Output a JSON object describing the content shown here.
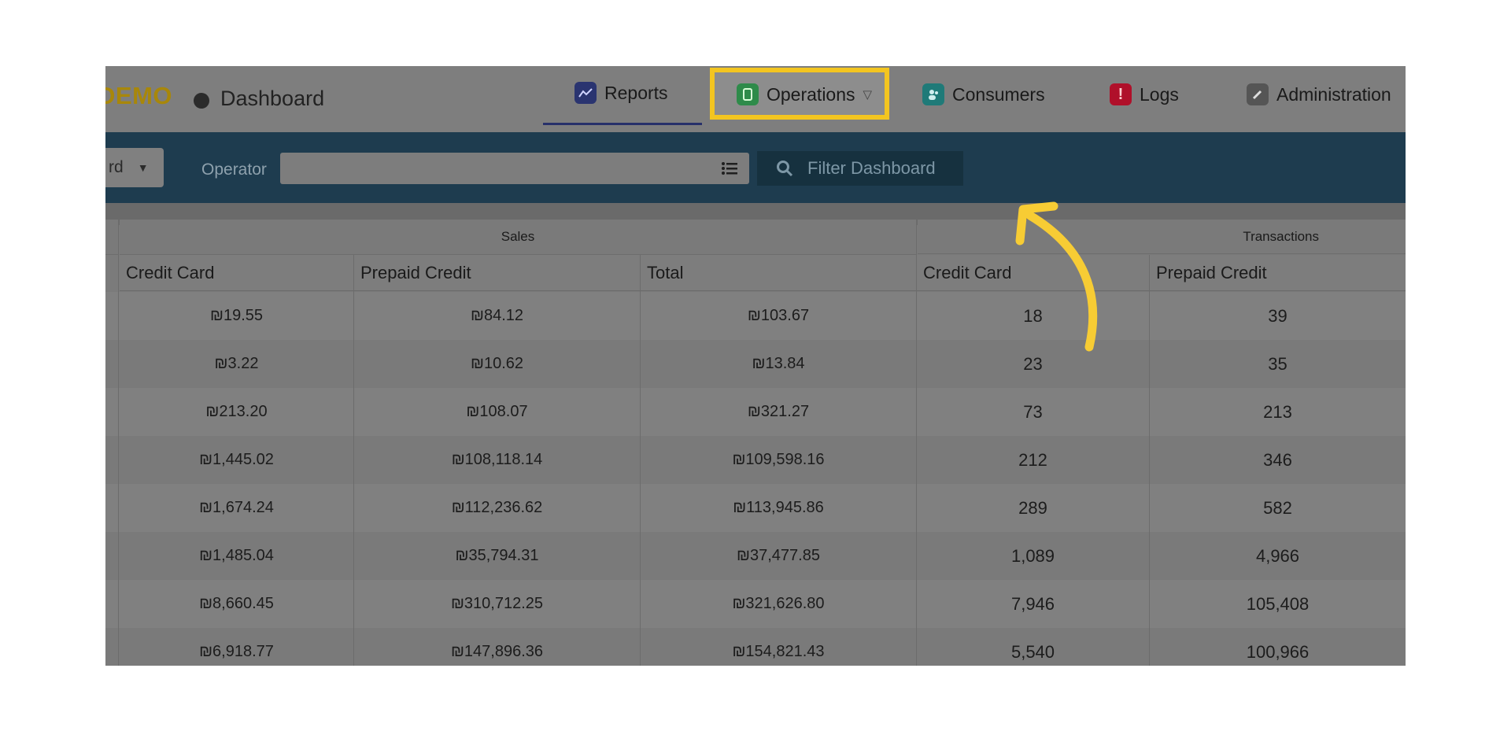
{
  "brand": "DEMO",
  "dashboard_label": "Dashboard",
  "nav": {
    "reports": "Reports",
    "operations": "Operations",
    "consumers": "Consumers",
    "logs": "Logs",
    "administration": "Administration"
  },
  "filter": {
    "select_value": "rd",
    "operator_label": "Operator",
    "operator_value": "",
    "filter_button": "Filter Dashboard"
  },
  "table": {
    "groups": [
      "Sales",
      "Transactions"
    ],
    "columns": [
      "Credit Card",
      "Prepaid Credit",
      "Total",
      "Credit Card",
      "Prepaid Credit"
    ],
    "rows": [
      [
        "₪19.55",
        "₪84.12",
        "₪103.67",
        "18",
        "39"
      ],
      [
        "₪3.22",
        "₪10.62",
        "₪13.84",
        "23",
        "35"
      ],
      [
        "₪213.20",
        "₪108.07",
        "₪321.27",
        "73",
        "213"
      ],
      [
        "₪1,445.02",
        "₪108,118.14",
        "₪109,598.16",
        "212",
        "346"
      ],
      [
        "₪1,674.24",
        "₪112,236.62",
        "₪113,945.86",
        "289",
        "582"
      ],
      [
        "₪1,485.04",
        "₪35,794.31",
        "₪37,477.85",
        "1,089",
        "4,966"
      ],
      [
        "₪8,660.45",
        "₪310,712.25",
        "₪321,626.80",
        "7,946",
        "105,408"
      ],
      [
        "₪6,918.77",
        "₪147,896.36",
        "₪154,821.43",
        "5,540",
        "100,966"
      ]
    ]
  },
  "colors": {
    "highlight": "#f3c520",
    "filter_bar": "#1e3c4f",
    "reports_icon": "#2a3470",
    "operations_icon": "#2e8b4a",
    "consumers_icon": "#1f7a78",
    "logs_icon": "#b0102a",
    "administration_icon": "#555555"
  },
  "icons": {
    "reports": "chart-line-icon",
    "operations": "clipboard-icon",
    "consumers": "users-icon",
    "logs": "alert-icon",
    "administration": "wrench-icon",
    "operator": "list-icon",
    "filter": "search-icon"
  }
}
